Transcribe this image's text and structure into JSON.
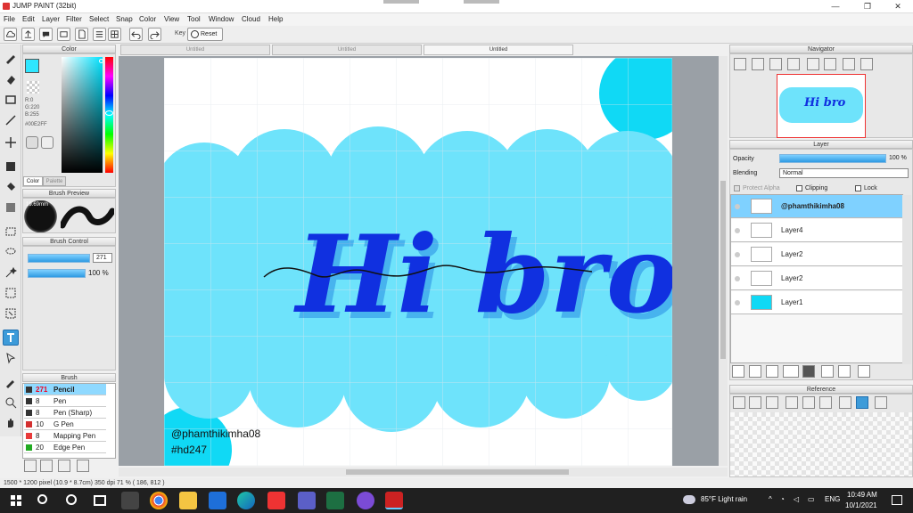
{
  "window": {
    "title": "JUMP PAINT (32bit)"
  },
  "menu": [
    "File",
    "Edit",
    "Layer",
    "Filter",
    "Select",
    "Snap",
    "Color",
    "View",
    "Tool",
    "Window",
    "Cloud",
    "Help"
  ],
  "toolbar": {
    "key_label": "Key",
    "reset_label": "Reset"
  },
  "color_panel": {
    "title": "Color",
    "r": "R:0",
    "g": "G:220",
    "b": "B:255",
    "hex": "#00E2FF",
    "tab_color": "Color",
    "tab_palette": "Palette",
    "current_color": "#2ee6ff"
  },
  "brush_preview": {
    "title": "Brush Preview",
    "size_label": "19.69mm"
  },
  "brush_control": {
    "title": "Brush Control",
    "size_value": "271",
    "opacity_value": "100 %"
  },
  "brush_panel": {
    "title": "Brush",
    "items": [
      {
        "size": "271",
        "name": "Pencil",
        "color": "#333333",
        "selected": true
      },
      {
        "size": "8",
        "name": "Pen",
        "color": "#333333"
      },
      {
        "size": "8",
        "name": "Pen (Sharp)",
        "color": "#333333"
      },
      {
        "size": "10",
        "name": "G Pen",
        "color": "#d33030"
      },
      {
        "size": "8",
        "name": "Mapping Pen",
        "color": "#e83a3a"
      },
      {
        "size": "20",
        "name": "Edge Pen",
        "color": "#22aa22"
      }
    ]
  },
  "doc_tabs": [
    "Untitled",
    "Untitled",
    "Untitled"
  ],
  "canvas": {
    "text": "Hi bro",
    "handle": "@phamthikimha08",
    "hashtag": "#hd247",
    "cloud_color": "#6ee3fb",
    "text_color": "#1030e0"
  },
  "navigator": {
    "title": "Navigator"
  },
  "layer_panel": {
    "title": "Layer",
    "opacity_label": "Opacity",
    "opacity_value": "100 %",
    "blending_label": "Blending",
    "blending_value": "Normal",
    "protect_alpha": "Protect Alpha",
    "clipping": "Clipping",
    "lock": "Lock",
    "layers": [
      {
        "name": "@phamthikimha08",
        "selected": true
      },
      {
        "name": "Layer4"
      },
      {
        "name": "Layer2"
      },
      {
        "name": "Layer2"
      },
      {
        "name": "Layer1"
      }
    ]
  },
  "reference": {
    "title": "Reference"
  },
  "status": {
    "text": "1500 * 1200 pixel  (10.9 * 8.7cm)  350 dpi  71 %  ( 186, 812 )"
  },
  "taskbar": {
    "weather": "85°F  Light rain",
    "lang": "ENG",
    "time": "10:49 AM",
    "date": "10/1/2021"
  }
}
